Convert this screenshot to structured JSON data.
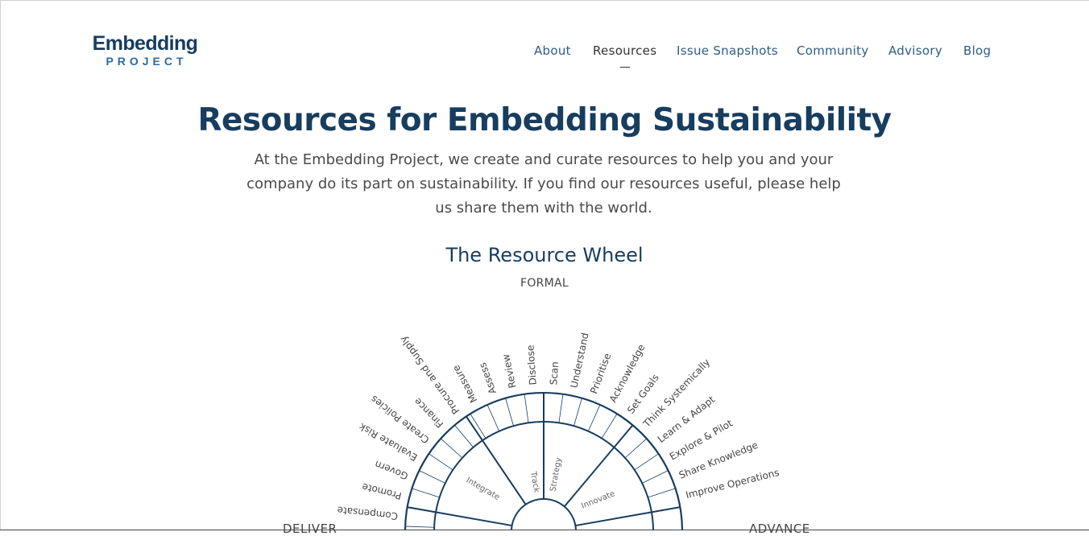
{
  "logo": {
    "line1": "Embedding",
    "line2": "PROJECT"
  },
  "nav": {
    "items": [
      "About",
      "Resources",
      "Issue Snapshots",
      "Community",
      "Advisory",
      "Blog"
    ],
    "active": "Resources"
  },
  "hero": {
    "title": "Resources for Embedding Sustainability",
    "intro": "At the Embedding Project, we create and curate resources to help you and your company do its part on sustainability. If you find our resources useful, please help us share them with the world."
  },
  "wheel": {
    "title": "The Resource Wheel",
    "top_label": "FORMAL",
    "left_label": "DELIVER",
    "right_label": "ADVANCE",
    "inner_labels": [
      "Integrate",
      "Track",
      "Strategy",
      "Innovate"
    ],
    "outer_labels": [
      "Compensate",
      "Promote",
      "Govern",
      "Evaluate Risk",
      "Create Policies",
      "Finance",
      "Procure and Supply",
      "Measure",
      "Assess",
      "Review",
      "Disclose",
      "Scan",
      "Understand",
      "Prioritise",
      "Acknowledge",
      "Set Goals",
      "Think Systemically",
      "Learn & Adapt",
      "Explore & Pilot",
      "Share Knowledge",
      "Improve Operations"
    ],
    "colors": {
      "stroke": "#173d5f",
      "text": "#444444"
    }
  }
}
